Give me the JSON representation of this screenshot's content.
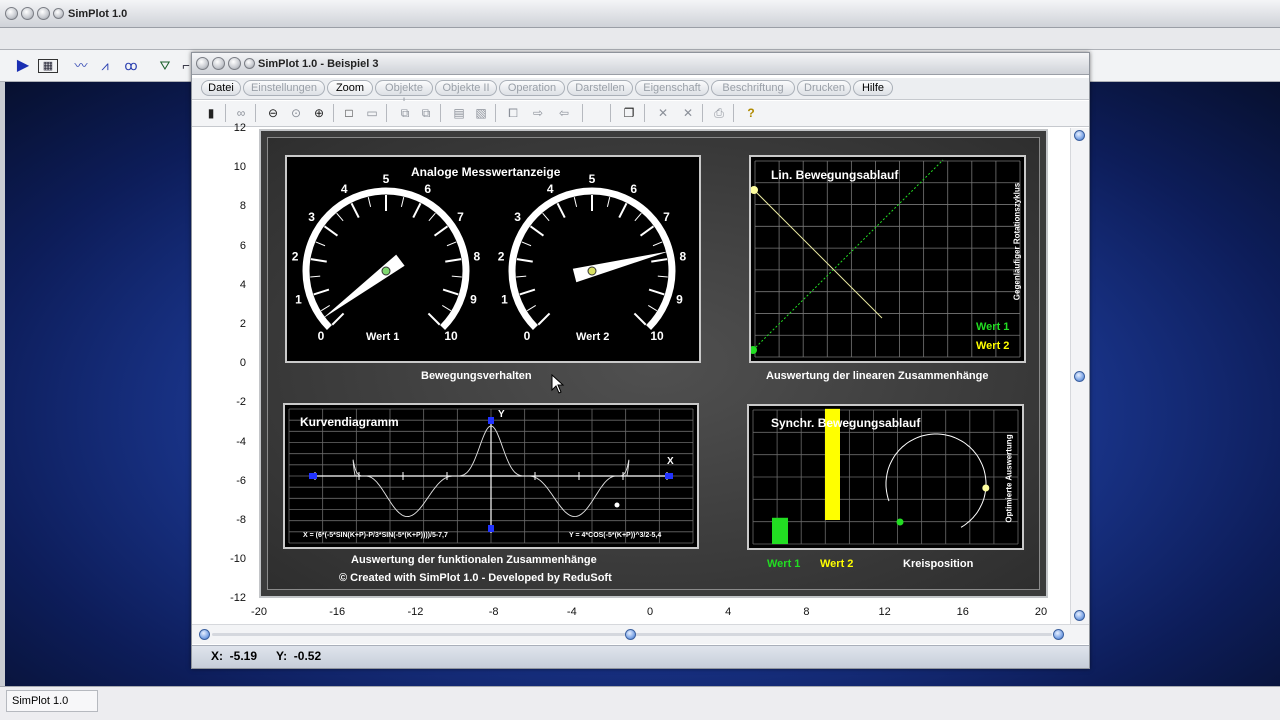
{
  "app": {
    "title": "SimPlot 1.0"
  },
  "doc": {
    "title": "SimPlot 1.0 - Beispiel 3"
  },
  "menu": [
    "Datei",
    "Einstellungen",
    "Zoom",
    "Objekte I",
    "Objekte II",
    "Operation",
    "Darstellen",
    "Eigenschaft",
    "Beschriftung",
    "Drucken",
    "Hilfe"
  ],
  "axes": {
    "y_ticks": [
      "12",
      "10",
      "8",
      "6",
      "4",
      "2",
      "0",
      "-2",
      "-4",
      "-6",
      "-8",
      "-10",
      "-12"
    ],
    "x_ticks": [
      "-20",
      "-16",
      "-12",
      "-8",
      "-4",
      "0",
      "4",
      "8",
      "12",
      "16",
      "20"
    ]
  },
  "gauge": {
    "title": "Analoge Messwertanzeige",
    "scale": [
      "0",
      "1",
      "2",
      "3",
      "4",
      "5",
      "6",
      "7",
      "8",
      "9",
      "10"
    ],
    "label1": "Wert 1",
    "label2": "Wert 2",
    "value1": 0.3,
    "value2": 7.8,
    "caption": "Bewegungsverhalten"
  },
  "linear": {
    "title": "Lin. Bewegungsablauf",
    "side_label": "Gegenläufiger Rotationszyklus",
    "legend1": "Wert 1",
    "legend2": "Wert 2",
    "caption": "Auswertung der linearen Zusammenhänge"
  },
  "curve": {
    "title": "Kurvendiagramm",
    "y_label": "Y",
    "x_label": "X",
    "formula_x": "X = (6*(-5*SIN(K+P)-P/3*SIN(-5*(K+P))))/5-7,7",
    "formula_y": "Y = 4*COS(-5*(K+P))^3/2-5,4",
    "caption": "Auswertung der funktionalen Zusammenhänge",
    "credit": "© Created with SimPlot 1.0 - Developed by ReduSoft"
  },
  "sync": {
    "title": "Synchr. Bewegungsablauf",
    "side_label": "Optimierte Auswertung",
    "legend1": "Wert 1",
    "legend2": "Wert 2",
    "legend3": "Kreisposition",
    "bar1": 0.19,
    "bar2": 0.82
  },
  "status": {
    "x": "X:  -5.19",
    "y": "Y:  -0.52"
  },
  "taskbar": {
    "item": "SimPlot 1.0"
  },
  "colors": {
    "green": "#22dd22",
    "yellow": "#ffff00",
    "panel_bg": "#000000",
    "board_bg": "#3a3a3a"
  }
}
